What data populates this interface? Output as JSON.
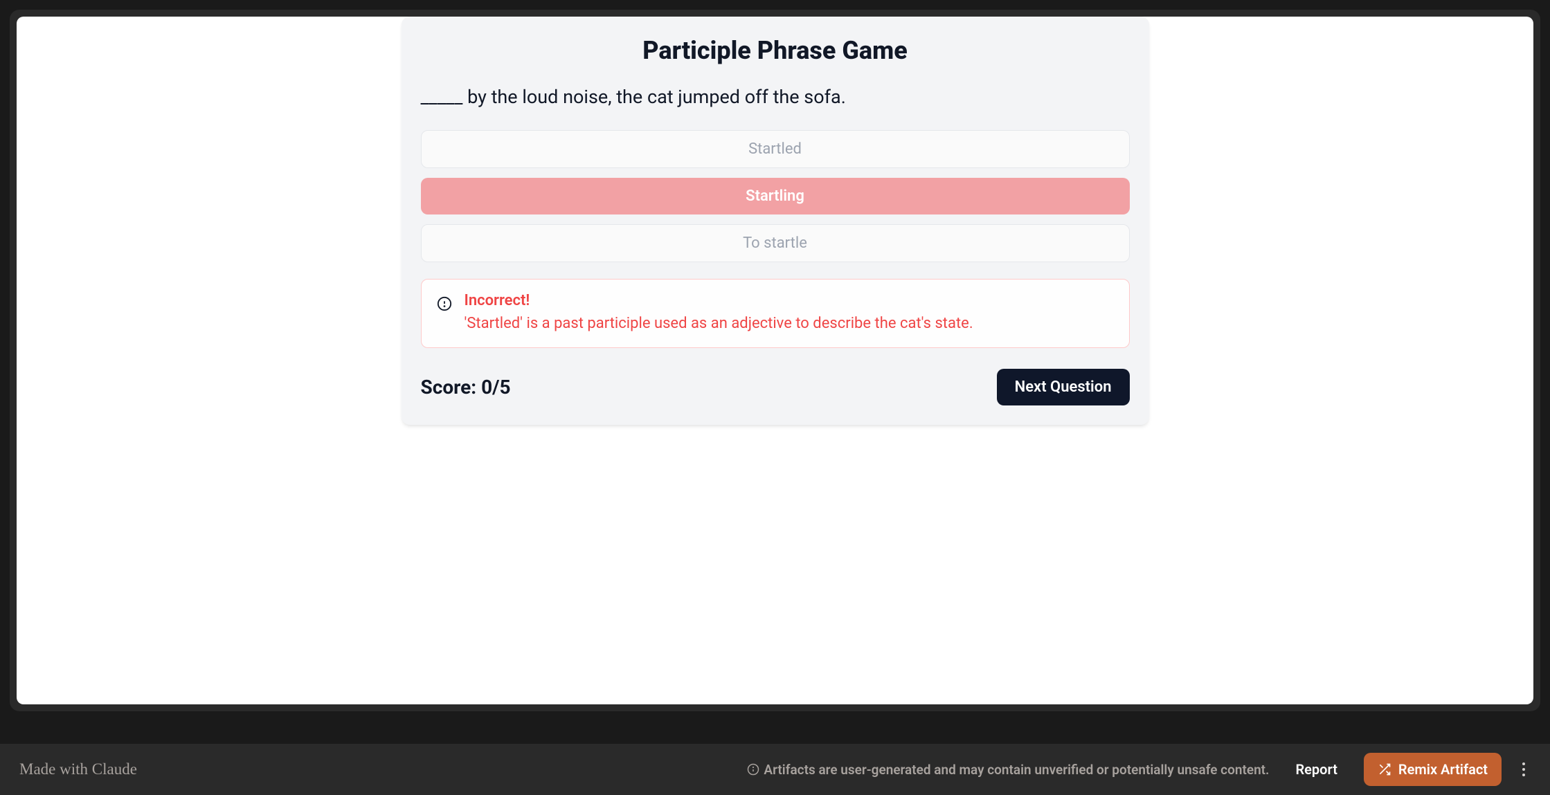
{
  "quiz": {
    "title": "Participle Phrase Game",
    "question": "_____ by the loud noise, the cat jumped off the sofa.",
    "options": [
      {
        "label": "Startled",
        "selected": false,
        "wrong": false
      },
      {
        "label": "Startling",
        "selected": true,
        "wrong": true
      },
      {
        "label": "To startle",
        "selected": false,
        "wrong": false
      }
    ],
    "feedback": {
      "status": "Incorrect!",
      "explanation": "'Startled' is a past participle used as an adjective to describe the cat's state."
    },
    "score_label": "Score: 0/5",
    "next_button": "Next Question"
  },
  "footer": {
    "made_with": "Made with ",
    "claude": "Claude",
    "disclaimer": "Artifacts are user-generated and may contain unverified or potentially unsafe content.",
    "report": "Report",
    "remix": "Remix Artifact"
  }
}
